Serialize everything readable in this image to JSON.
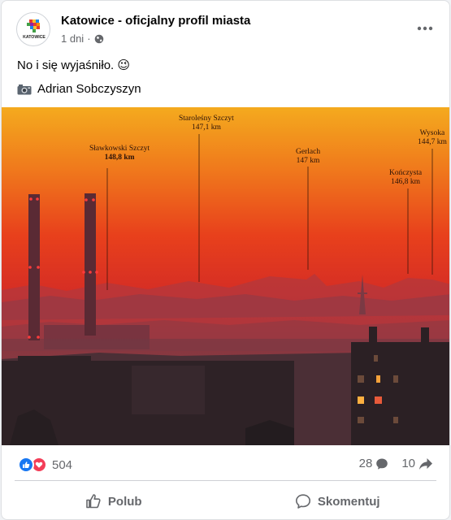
{
  "post": {
    "page_name": "Katowice - oficjalny profil miasta",
    "time": "1 dni",
    "audience_icon": "globe-icon",
    "text": "No i się wyjaśniło. 😉",
    "photo_credit": "Adrian Sobczyszyn",
    "credit_icon": "camera-icon",
    "avatar_logo_text": "KATOWICE"
  },
  "photo": {
    "labels": [
      {
        "name": "Sławkowski Szczyt",
        "altitude": "148,8 km",
        "bold_altitude": true
      },
      {
        "name": "Staroleśny Szczyt",
        "altitude": "147,1 km",
        "bold_altitude": false
      },
      {
        "name": "Gerlach",
        "altitude": "147 km",
        "bold_altitude": false
      },
      {
        "name": "Kończysta",
        "altitude": "146,8 km",
        "bold_altitude": false
      },
      {
        "name": "Wysoka",
        "altitude": "144,7 km",
        "bold_altitude": false
      }
    ],
    "colors": {
      "sky_top": "#f2a01c",
      "sky_mid": "#e8401a",
      "sky_low": "#c62525",
      "haze": "#b0343a"
    }
  },
  "stats": {
    "reaction_count": "504",
    "comment_count": "28",
    "share_count": "10"
  },
  "actions": {
    "like_label": "Polub",
    "comment_label": "Skomentuj"
  },
  "colors": {
    "like_blue": "#1877f2",
    "love_red": "#f33e58",
    "secondary_text": "#65676b"
  }
}
